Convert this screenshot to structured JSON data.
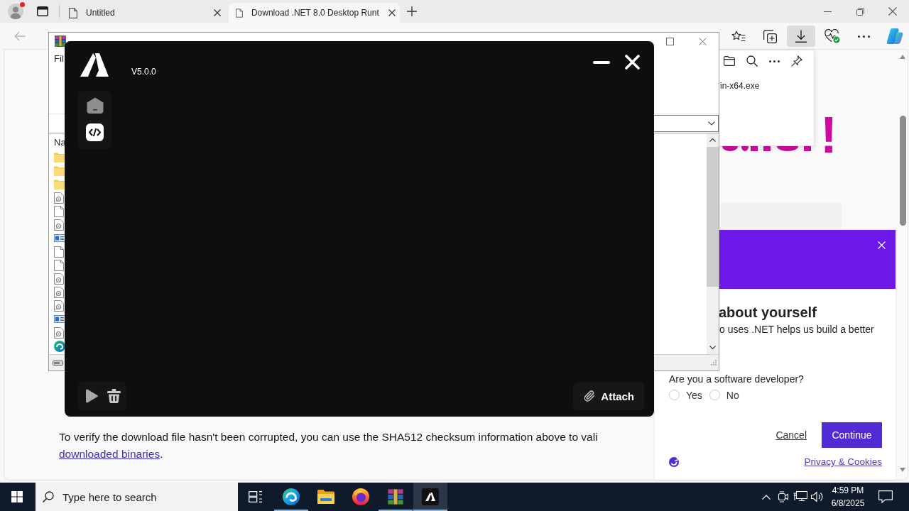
{
  "browser": {
    "tabs": [
      {
        "title": "Untitled",
        "selected": false
      },
      {
        "title": "Download .NET 8.0 Desktop Runt",
        "selected": true
      }
    ],
    "toolbar_buttons": [
      {
        "kind": "favorites",
        "selected": false
      },
      {
        "kind": "collections",
        "selected": false
      },
      {
        "kind": "downloads",
        "selected": true
      },
      {
        "kind": "essentials",
        "selected": false
      },
      {
        "kind": "more",
        "selected": false
      },
      {
        "kind": "copilot",
        "selected": false
      }
    ],
    "downloads_panel": {
      "file_name": "in-x64.exe"
    },
    "page": {
      "heading": "!",
      "survey": {
        "heading": "about yourself",
        "text": "o uses .NET helps us build a better",
        "question": "Are you a software developer?",
        "options": [
          {
            "label": "Yes",
            "selected": false
          },
          {
            "label": "No",
            "selected": false
          }
        ],
        "cancel": "Cancel",
        "continue": "Continue",
        "privacy_link": "Privacy & Cookies"
      },
      "checksum_note": {
        "text": "To verify the download file hasn't been corrupted, you can use the SHA512 checksum information above to vali",
        "link": "downloaded binaries",
        "end": "."
      }
    }
  },
  "archive_window": {
    "menu_item": "Fil",
    "column_header": "Na",
    "files": [
      {
        "kind": "folder"
      },
      {
        "kind": "folder"
      },
      {
        "kind": "folder"
      },
      {
        "kind": "settings"
      },
      {
        "kind": "blank"
      },
      {
        "kind": "settings"
      },
      {
        "kind": "app"
      },
      {
        "kind": "blank"
      },
      {
        "kind": "blank"
      },
      {
        "kind": "settings"
      },
      {
        "kind": "settings"
      },
      {
        "kind": "settings"
      },
      {
        "kind": "app"
      },
      {
        "kind": "settings"
      },
      {
        "kind": "edge"
      }
    ]
  },
  "app_window": {
    "version": "V5.0.0",
    "nav": [
      {
        "kind": "home",
        "selected": false
      },
      {
        "kind": "code",
        "selected": true
      }
    ],
    "attach_label": "Attach"
  },
  "taskbar": {
    "search_placeholder": "Type here to search",
    "apps": [
      {
        "kind": "edge",
        "running": true,
        "selected": false
      },
      {
        "kind": "explorer",
        "running": false,
        "selected": false
      },
      {
        "kind": "firefox",
        "running": false,
        "selected": false
      },
      {
        "kind": "winrar",
        "running": true,
        "selected": false
      },
      {
        "kind": "app",
        "running": true,
        "selected": true
      }
    ],
    "time": "4:59 PM",
    "date": "6/8/2025"
  }
}
